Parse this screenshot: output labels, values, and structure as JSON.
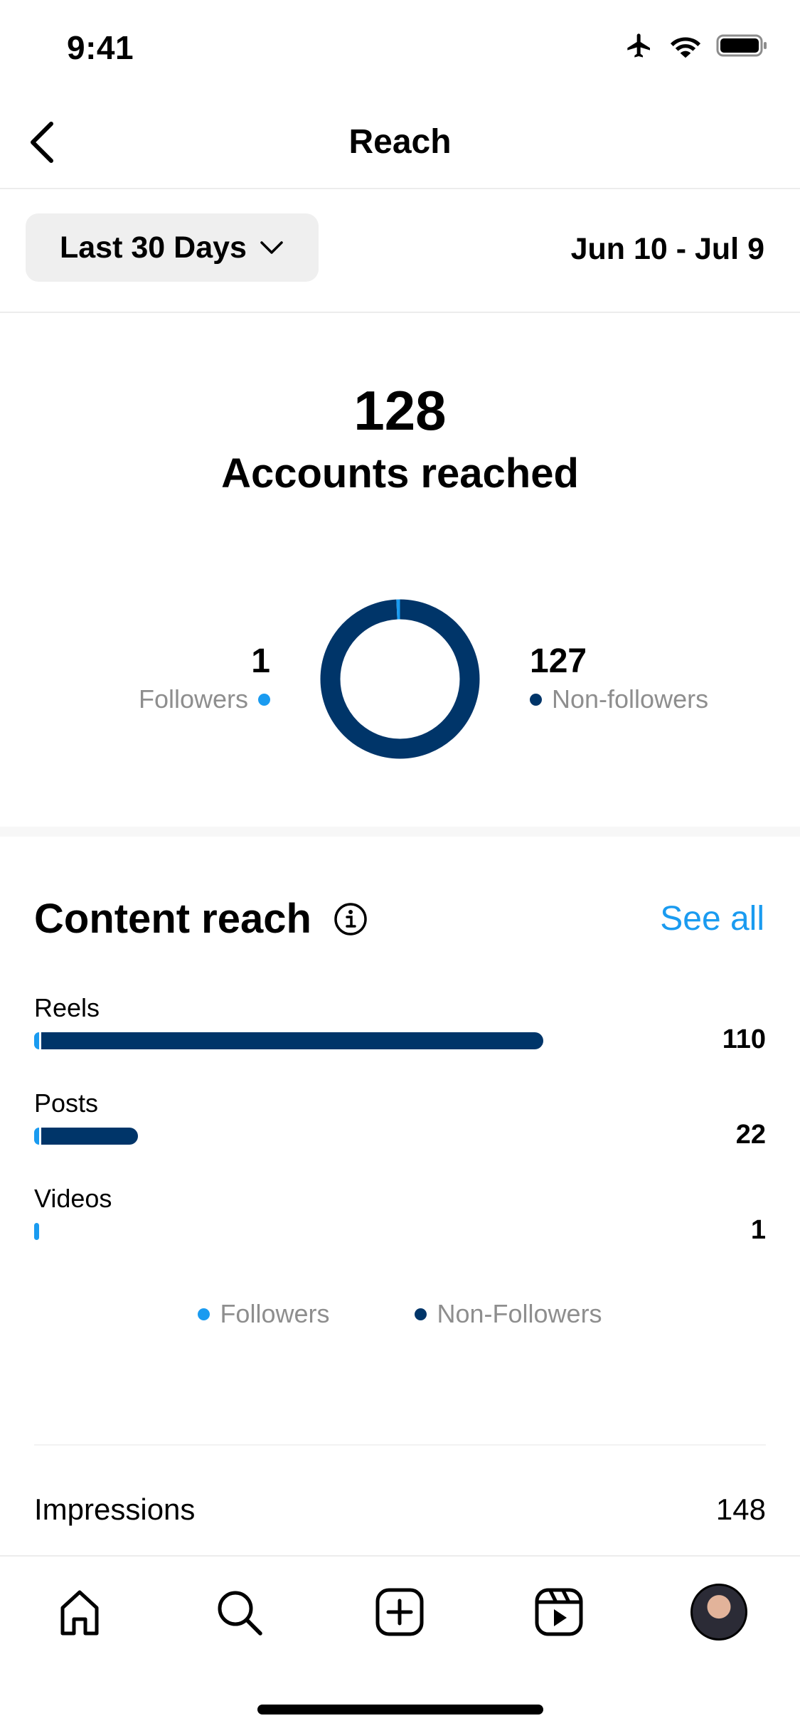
{
  "status_bar": {
    "time": "9:41"
  },
  "header": {
    "title": "Reach"
  },
  "filter": {
    "range_label": "Last 30 Days",
    "date_range": "Jun 10 - Jul 9"
  },
  "summary": {
    "accounts_reached": "128",
    "accounts_label": "Accounts reached",
    "followers_count": "1",
    "followers_label": "Followers",
    "nonfollowers_count": "127",
    "nonfollowers_label": "Non-followers"
  },
  "content_reach": {
    "title": "Content reach",
    "see_all": "See all",
    "rows": [
      {
        "label": "Reels",
        "value": "110",
        "followers": 1,
        "nonfollowers": 109
      },
      {
        "label": "Posts",
        "value": "22",
        "followers": 1,
        "nonfollowers": 21
      },
      {
        "label": "Videos",
        "value": "1",
        "followers": 1,
        "nonfollowers": 0
      }
    ],
    "legend": {
      "followers": "Followers",
      "nonfollowers": "Non-Followers"
    }
  },
  "impressions": {
    "label": "Impressions",
    "value": "148"
  },
  "colors": {
    "followers": "#1a9bf0",
    "nonfollowers": "#003569",
    "accent": "#1a9bf0"
  },
  "tabs": [
    "home-icon",
    "search-icon",
    "create-icon",
    "reels-icon",
    "profile-avatar"
  ]
}
